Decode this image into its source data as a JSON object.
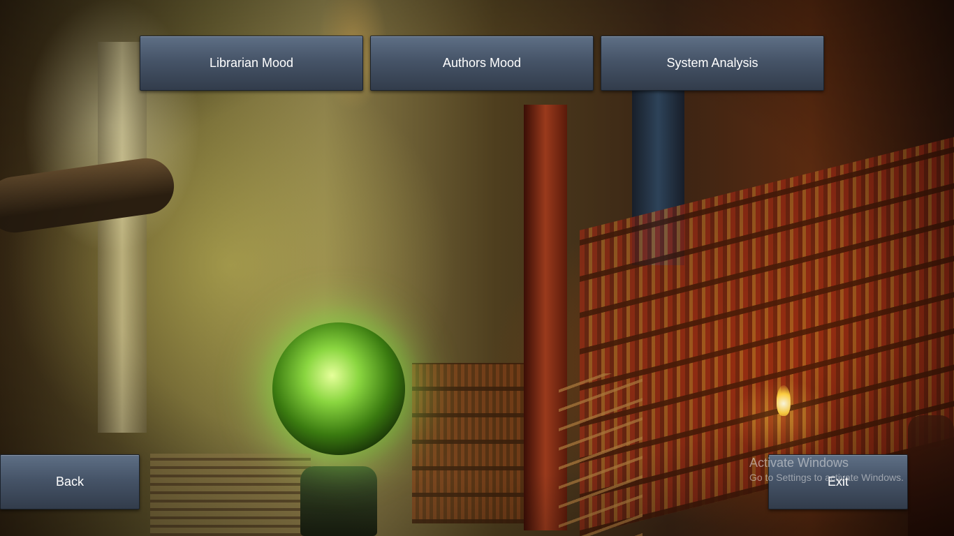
{
  "menu": {
    "librarian_mood_label": "Librarian Mood",
    "authors_mood_label": "Authors Mood",
    "system_analysis_label": "System Analysis"
  },
  "footer": {
    "back_label": "Back",
    "exit_label": "Exit"
  },
  "watermark": {
    "title": "Activate Windows",
    "subtitle": "Go to Settings to activate Windows."
  },
  "background": {
    "scene": "fantasy-library-illustration"
  },
  "colors": {
    "button_top": "#5e6f85",
    "button_bottom": "#323c4b",
    "button_text": "#ffffff"
  }
}
